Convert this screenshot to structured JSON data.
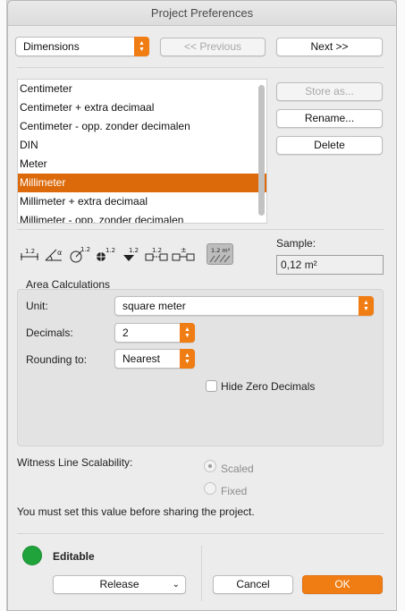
{
  "window": {
    "title": "Project Preferences"
  },
  "top": {
    "category_select": "Dimensions",
    "previous_label": "<< Previous",
    "next_label": "Next >>"
  },
  "list": {
    "items": [
      "Centimeter",
      "Centimeter + extra decimaal",
      "Centimeter - opp. zonder decimalen",
      "DIN",
      "Meter",
      "Millimeter",
      "Millimeter + extra decimaal",
      "Millimeter - opp. zonder decimalen"
    ],
    "selected": "Millimeter"
  },
  "side_buttons": {
    "store_as": "Store as...",
    "rename": "Rename...",
    "delete": "Delete"
  },
  "sample": {
    "label": "Sample:",
    "value": "0,12 m²"
  },
  "toolbar_icons": [
    "linear-dimension-icon",
    "angle-dimension-icon",
    "radial-dimension-icon",
    "level-dimension-icon",
    "elevation-dimension-icon",
    "door-window-dimension-icon",
    "sill-height-dimension-icon",
    "area-calculation-icon"
  ],
  "icon_text": {
    "num": "1.2",
    "area": "1.2 m²"
  },
  "area": {
    "heading": "Area Calculations",
    "unit_label": "Unit:",
    "unit_value": "square meter",
    "decimals_label": "Decimals:",
    "decimals_value": "2",
    "rounding_label": "Rounding to:",
    "rounding_value": "Nearest",
    "hide_zero_label": "Hide Zero Decimals"
  },
  "witness": {
    "label": "Witness Line Scalability:",
    "scaled": "Scaled",
    "fixed": "Fixed",
    "note": "You must set this value before sharing the project."
  },
  "footer": {
    "status": "Editable",
    "release": "Release",
    "cancel": "Cancel",
    "ok": "OK"
  },
  "colors": {
    "accent": "#f07d13",
    "selection": "#dc6a0a",
    "status_green": "#1fa33a"
  }
}
